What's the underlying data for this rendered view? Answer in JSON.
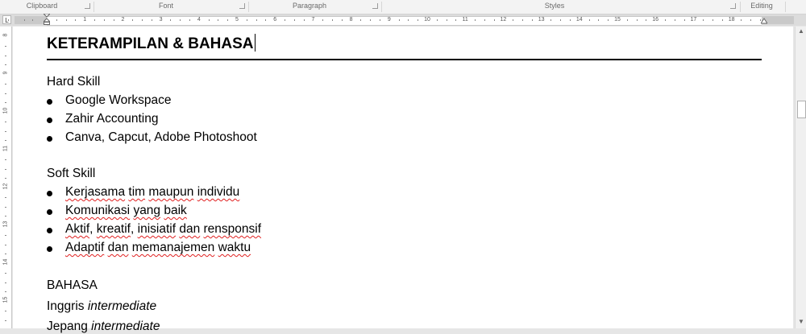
{
  "ribbon": {
    "groups": [
      {
        "label": "Clipboard"
      },
      {
        "label": "Font"
      },
      {
        "label": "Paragraph"
      },
      {
        "label": "Styles"
      },
      {
        "label": "Editing"
      }
    ]
  },
  "ruler": {
    "tab_selector": "L",
    "numbers": [
      "1",
      "2",
      "3",
      "4",
      "5",
      "6",
      "7",
      "8",
      "9",
      "10",
      "11",
      "12",
      "13",
      "14",
      "15",
      "16",
      "17",
      "18"
    ],
    "vertical_numbers": [
      "8",
      "9",
      "10",
      "11",
      "12",
      "13",
      "14",
      "15"
    ]
  },
  "document": {
    "heading": "KETERAMPILAN & BAHASA",
    "hard_skill_title": "Hard Skill",
    "hard_skills": [
      "Google Workspace",
      "Zahir Accounting",
      "Canva, Capcut, Adobe Photoshoot"
    ],
    "soft_skill_title": "Soft Skill",
    "soft_skills": [
      {
        "segments": [
          [
            "Kerjasama",
            true
          ],
          [
            " ",
            false
          ],
          [
            "tim",
            true
          ],
          [
            " ",
            false
          ],
          [
            "maupun",
            true
          ],
          [
            " ",
            false
          ],
          [
            "individu",
            true
          ]
        ]
      },
      {
        "segments": [
          [
            "Komunikasi",
            true
          ],
          [
            " ",
            false
          ],
          [
            "yang",
            true
          ],
          [
            " ",
            false
          ],
          [
            "baik",
            true
          ]
        ]
      },
      {
        "segments": [
          [
            "Aktif",
            true
          ],
          [
            ", ",
            false
          ],
          [
            "kreatif",
            true
          ],
          [
            ", ",
            false
          ],
          [
            "inisiatif",
            true
          ],
          [
            " ",
            false
          ],
          [
            "dan",
            true
          ],
          [
            " ",
            false
          ],
          [
            "rensponsif",
            true
          ]
        ]
      },
      {
        "segments": [
          [
            "Adaptif",
            true
          ],
          [
            " ",
            false
          ],
          [
            "dan",
            true
          ],
          [
            " ",
            false
          ],
          [
            "memanajemen",
            true
          ],
          [
            " ",
            false
          ],
          [
            "waktu",
            true
          ]
        ]
      }
    ],
    "bahasa_title": "BAHASA",
    "languages": [
      {
        "name": "Inggris",
        "level": "intermediate"
      },
      {
        "name": "Jepang",
        "level": "intermediate"
      }
    ]
  }
}
